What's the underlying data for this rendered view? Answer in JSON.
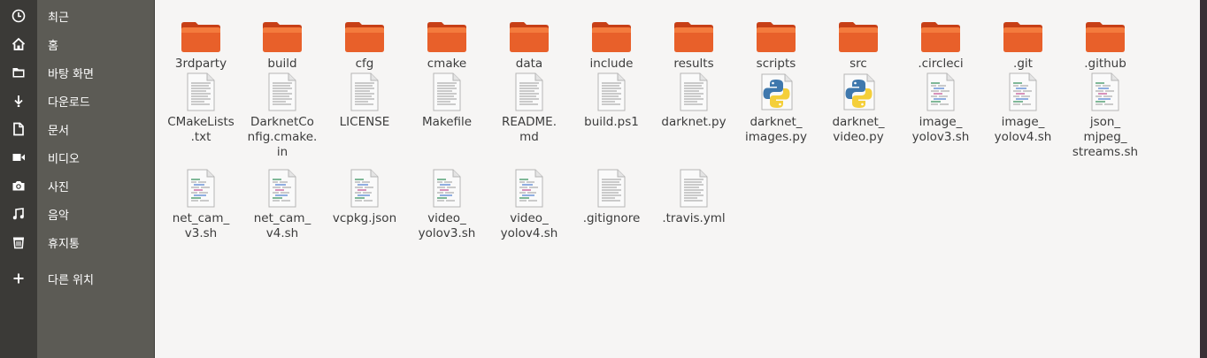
{
  "sidebar": {
    "items": [
      {
        "icon": "clock-icon",
        "label": "최근"
      },
      {
        "icon": "home-icon",
        "label": "홈"
      },
      {
        "icon": "folder-icon",
        "label": "바탕 화면"
      },
      {
        "icon": "download-icon",
        "label": "다운로드"
      },
      {
        "icon": "document-icon",
        "label": "문서"
      },
      {
        "icon": "video-icon",
        "label": "비디오"
      },
      {
        "icon": "camera-icon",
        "label": "사진"
      },
      {
        "icon": "music-icon",
        "label": "음악"
      },
      {
        "icon": "trash-icon",
        "label": "휴지통"
      },
      {
        "icon": "plus-icon",
        "label": "다른 위치"
      }
    ]
  },
  "files": {
    "rows": [
      [
        {
          "type": "folder",
          "name": "3rdparty"
        },
        {
          "type": "folder",
          "name": "build"
        },
        {
          "type": "folder",
          "name": "cfg"
        },
        {
          "type": "folder",
          "name": "cmake"
        },
        {
          "type": "folder",
          "name": "data"
        },
        {
          "type": "folder",
          "name": "include"
        },
        {
          "type": "folder",
          "name": "results"
        },
        {
          "type": "folder",
          "name": "scripts"
        },
        {
          "type": "folder",
          "name": "src"
        },
        {
          "type": "folder",
          "name": ".circleci"
        },
        {
          "type": "folder",
          "name": ".git"
        },
        {
          "type": "folder",
          "name": ".github"
        }
      ],
      [
        {
          "type": "text",
          "name": "CMakeLists\n.txt"
        },
        {
          "type": "text",
          "name": "DarknetCo\nnfig.cmake.\nin"
        },
        {
          "type": "text",
          "name": "LICENSE"
        },
        {
          "type": "text",
          "name": "Makefile"
        },
        {
          "type": "text",
          "name": "README.\nmd"
        },
        {
          "type": "text",
          "name": "build.ps1"
        },
        {
          "type": "text",
          "name": "darknet.py"
        },
        {
          "type": "python",
          "name": "darknet_\nimages.py"
        },
        {
          "type": "python",
          "name": "darknet_\nvideo.py"
        },
        {
          "type": "script",
          "name": "image_\nyolov3.sh"
        },
        {
          "type": "script",
          "name": "image_\nyolov4.sh"
        },
        {
          "type": "script",
          "name": "json_\nmjpeg_\nstreams.sh"
        }
      ],
      [
        {
          "type": "script",
          "name": "net_cam_\nv3.sh"
        },
        {
          "type": "script",
          "name": "net_cam_\nv4.sh"
        },
        {
          "type": "script",
          "name": "vcpkg.json"
        },
        {
          "type": "script",
          "name": "video_\nyolov3.sh"
        },
        {
          "type": "script",
          "name": "video_\nyolov4.sh"
        },
        {
          "type": "text",
          "name": ".gitignore"
        },
        {
          "type": "text",
          "name": ".travis.yml"
        }
      ]
    ]
  },
  "colors": {
    "folder_dark": "#d8481c",
    "folder_light": "#f07a3b",
    "sidebar_bg": "#5c5b55",
    "icon_strip_bg": "#3b3a37"
  }
}
